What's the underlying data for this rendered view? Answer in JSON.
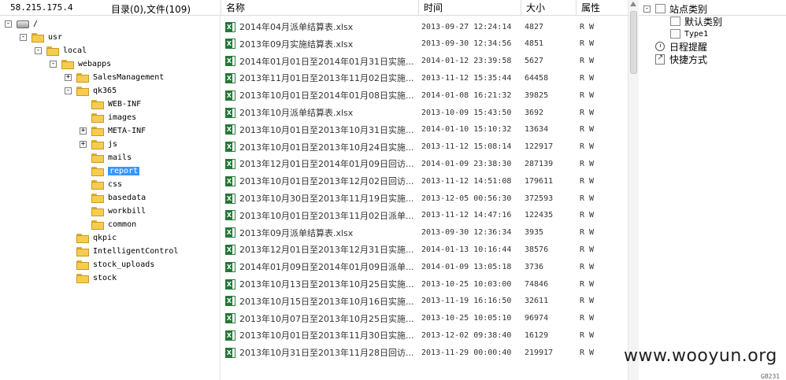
{
  "header": {
    "ip": "58.215.175.4",
    "dir_count": "目录(0),文件(109)",
    "col_name": "名称",
    "col_time": "时间",
    "col_size": "大小",
    "col_attr": "属性"
  },
  "tree": [
    {
      "label": "/",
      "toggle": "⊟",
      "kind": "drive"
    },
    {
      "label": "usr",
      "toggle": "⊟",
      "kind": "folder"
    },
    {
      "label": "local",
      "toggle": "⊟",
      "kind": "folder"
    },
    {
      "label": "webapps",
      "toggle": "⊟",
      "kind": "folder"
    },
    {
      "label": "SalesManagement",
      "toggle": "+",
      "kind": "folder"
    },
    {
      "label": "qk365",
      "toggle": "-",
      "kind": "folder"
    },
    {
      "label": "WEB-INF",
      "toggle": "",
      "kind": "folder"
    },
    {
      "label": "images",
      "toggle": "",
      "kind": "folder"
    },
    {
      "label": "META-INF",
      "toggle": "+",
      "kind": "folder"
    },
    {
      "label": "js",
      "toggle": "+",
      "kind": "folder"
    },
    {
      "label": "mails",
      "toggle": "",
      "kind": "folder"
    },
    {
      "label": "report",
      "toggle": "",
      "kind": "folder",
      "selected": true
    },
    {
      "label": "css",
      "toggle": "",
      "kind": "folder"
    },
    {
      "label": "basedata",
      "toggle": "",
      "kind": "folder"
    },
    {
      "label": "workbill",
      "toggle": "",
      "kind": "folder"
    },
    {
      "label": "common",
      "toggle": "",
      "kind": "folder"
    },
    {
      "label": "qkpic",
      "toggle": "",
      "kind": "folder"
    },
    {
      "label": "IntelligentControl",
      "toggle": "",
      "kind": "folder"
    },
    {
      "label": "stock_uploads",
      "toggle": "",
      "kind": "folder"
    },
    {
      "label": "stock",
      "toggle": "",
      "kind": "folder"
    }
  ],
  "files": [
    {
      "name": "2014年04月派单结算表.xlsx",
      "time": "2013-09-27 12:24:14",
      "size": "4827",
      "attr": "R W"
    },
    {
      "name": "2013年09月实施结算表.xlsx",
      "time": "2013-09-30 12:34:56",
      "size": "4851",
      "attr": "R W"
    },
    {
      "name": "2014年01月01日至2014年01月31日实施...",
      "time": "2014-01-12 23:39:58",
      "size": "5627",
      "attr": "R W"
    },
    {
      "name": "2013年11月01日至2013年11月02日实施...",
      "time": "2013-11-12 15:35:44",
      "size": "64458",
      "attr": "R W"
    },
    {
      "name": "2013年10月01日至2014年01月08日实施...",
      "time": "2014-01-08 16:21:32",
      "size": "39825",
      "attr": "R W"
    },
    {
      "name": "2013年10月派单结算表.xlsx",
      "time": "2013-10-09 15:43:50",
      "size": "3692",
      "attr": "R W"
    },
    {
      "name": "2013年10月01日至2013年10月31日实施...",
      "time": "2014-01-10 15:10:32",
      "size": "13634",
      "attr": "R W"
    },
    {
      "name": "2013年10月01日至2013年10月24日实施...",
      "time": "2013-11-12 15:08:14",
      "size": "122917",
      "attr": "R W"
    },
    {
      "name": "2013年12月01日至2014年01月09日回访...",
      "time": "2014-01-09 23:38:30",
      "size": "287139",
      "attr": "R W"
    },
    {
      "name": "2013年10月01日至2013年12月02日回访...",
      "time": "2013-11-12 14:51:08",
      "size": "179611",
      "attr": "R W"
    },
    {
      "name": "2013年10月30日至2013年11月19日实施...",
      "time": "2013-12-05 00:56:30",
      "size": "372593",
      "attr": "R W"
    },
    {
      "name": "2013年10月01日至2013年11月02日派单...",
      "time": "2013-11-12 14:47:16",
      "size": "122435",
      "attr": "R W"
    },
    {
      "name": "2013年09月派单结算表.xlsx",
      "time": "2013-09-30 12:36:34",
      "size": "3935",
      "attr": "R W"
    },
    {
      "name": "2013年12月01日至2013年12月31日实施...",
      "time": "2014-01-13 10:16:44",
      "size": "38576",
      "attr": "R W"
    },
    {
      "name": "2014年01月09日至2014年01月09日派单...",
      "time": "2014-01-09 13:05:18",
      "size": "3736",
      "attr": "R W"
    },
    {
      "name": "2013年10月13日至2013年10月25日实施...",
      "time": "2013-10-25 10:03:00",
      "size": "74846",
      "attr": "R W"
    },
    {
      "name": "2013年10月15日至2013年10月16日实施...",
      "time": "2013-11-19 16:16:50",
      "size": "32611",
      "attr": "R W"
    },
    {
      "name": "2013年10月07日至2013年10月25日实施...",
      "time": "2013-10-25 10:05:10",
      "size": "96974",
      "attr": "R W"
    },
    {
      "name": "2013年10月01日至2013年11月30日实施...",
      "time": "2013-12-02 09:38:40",
      "size": "16129",
      "attr": "R W"
    },
    {
      "name": "2013年10月31日至2013年11月28日回访...",
      "time": "2013-11-29 00:00:40",
      "size": "219917",
      "attr": "R W"
    }
  ],
  "panel": {
    "site_category": "站点类别",
    "default_category": "默认类别",
    "type1": "Type1",
    "schedule_reminder": "日程提醒",
    "shortcuts": "快捷方式"
  },
  "watermark": "www.wooyun.org",
  "corner_code": "GB231"
}
